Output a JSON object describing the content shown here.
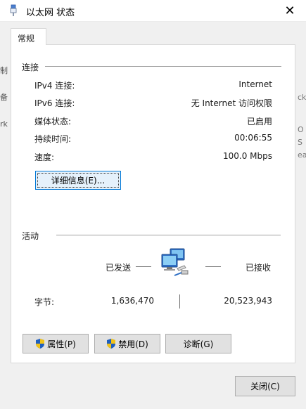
{
  "window": {
    "title": "以太网 状态"
  },
  "tabs": [
    {
      "label": "常规"
    }
  ],
  "connection": {
    "title": "连接",
    "rows": [
      {
        "label": "IPv4 连接:",
        "value": "Internet"
      },
      {
        "label": "IPv6 连接:",
        "value": "无 Internet 访问权限"
      },
      {
        "label": "媒体状态:",
        "value": "已启用"
      },
      {
        "label": "持续时间:",
        "value": "00:06:55"
      },
      {
        "label": "速度:",
        "value": "100.0 Mbps"
      }
    ],
    "details_button": "详细信息(E)..."
  },
  "activity": {
    "title": "活动",
    "sent_label": "已发送",
    "received_label": "已接收",
    "bytes_label": "字节:",
    "bytes_sent": "1,636,470",
    "bytes_received": "20,523,943",
    "network_icon": "network-computers-icon"
  },
  "buttons": {
    "properties": "属性(P)",
    "disable": "禁用(D)",
    "diagnose": "诊断(G)",
    "close": "关闭(C)"
  },
  "background_fragments": {
    "left": [
      "制",
      "备",
      "rk"
    ],
    "right": [
      "ck",
      "O",
      "S",
      "ea"
    ]
  },
  "colors": {
    "focus_border": "#0078d7",
    "button_bg": "#e1e1e1",
    "shield_blue": "#1f5fbf",
    "shield_yellow": "#f2c318"
  }
}
